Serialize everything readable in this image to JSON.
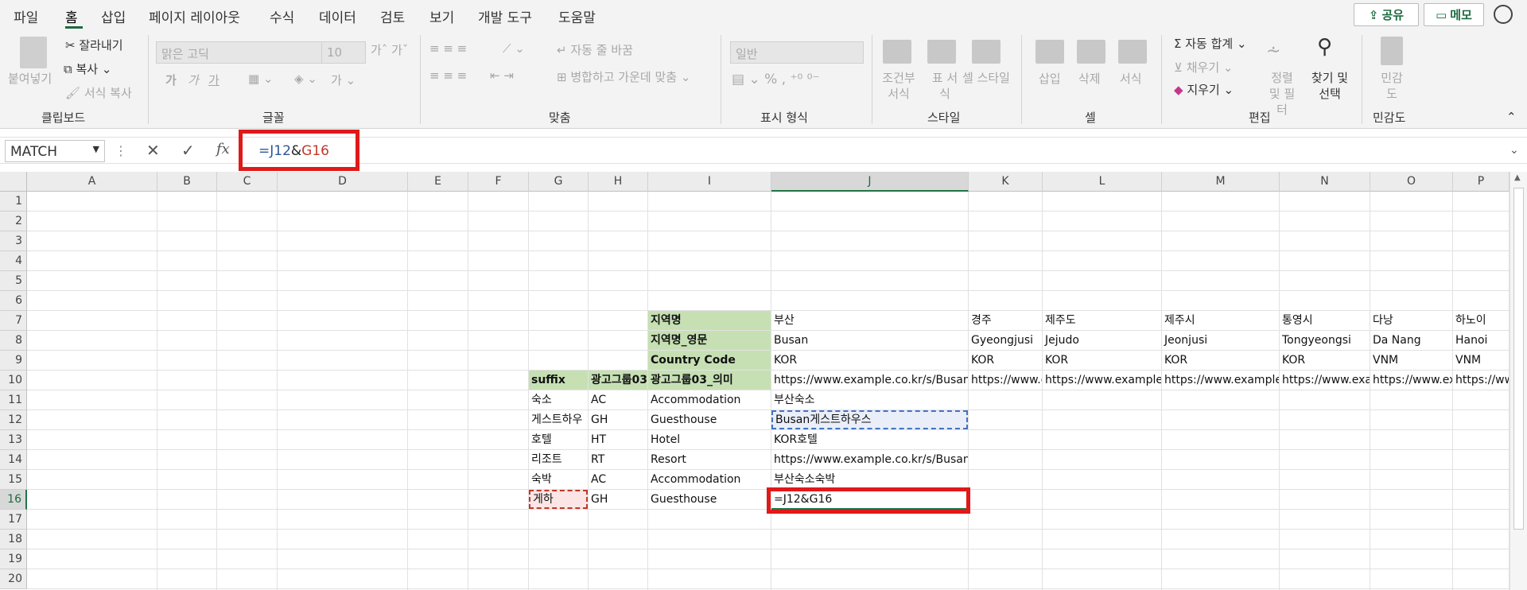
{
  "menu": {
    "items": [
      "파일",
      "홈",
      "삽입",
      "페이지 레이아웃",
      "수식",
      "데이터",
      "검토",
      "보기",
      "개발 도구",
      "도움말"
    ],
    "active_index": 1
  },
  "top_buttons": {
    "share": "공유",
    "comment": "메모"
  },
  "ribbon": {
    "clipboard": {
      "paste": "붙여넣기",
      "cut": "잘라내기",
      "copy": "복사",
      "format_painter": "서식 복사",
      "group": "클립보드"
    },
    "font": {
      "name": "맑은 고딕",
      "size": "10",
      "bold": "가",
      "italic": "가",
      "underline": "가",
      "group": "글꼴"
    },
    "alignment": {
      "wrap": "자동 줄 바꿈",
      "merge": "병합하고 가운데 맞춤",
      "group": "맞춤"
    },
    "number": {
      "format": "일반",
      "group": "표시 형식"
    },
    "styles": {
      "conditional": "조건부 서식",
      "table": "표 서식",
      "cell": "셀 스타일",
      "group": "스타일"
    },
    "cells": {
      "insert": "삽입",
      "delete": "삭제",
      "format": "서식",
      "group": "셀"
    },
    "editing": {
      "autosum": "자동 합계",
      "fill": "채우기",
      "clear": "지우기",
      "sort": "정렬 및 필터",
      "find": "찾기 및 선택",
      "group": "편집"
    },
    "sensitivity": {
      "label": "민감도",
      "group": "민감도"
    }
  },
  "formula_bar": {
    "name_box": "MATCH",
    "formula_ref1": "=J12",
    "formula_amp": "&",
    "formula_ref2": "G16"
  },
  "columns": [
    "A",
    "B",
    "C",
    "D",
    "E",
    "F",
    "G",
    "H",
    "I",
    "J",
    "K",
    "L",
    "M",
    "N",
    "O",
    "P"
  ],
  "rows": [
    "1",
    "2",
    "3",
    "4",
    "5",
    "6",
    "7",
    "8",
    "9",
    "10",
    "11",
    "12",
    "13",
    "14",
    "15",
    "16",
    "17",
    "18",
    "19",
    "20"
  ],
  "cells": {
    "I7": "지역명",
    "J7": "부산",
    "K7": "경주",
    "L7": "제주도",
    "M7": "제주시",
    "N7": "통영시",
    "O7": "다낭",
    "P7": "하노이",
    "I8": "지역명_영문",
    "J8": "Busan",
    "K8": "Gyeongjusi",
    "L8": "Jejudo",
    "M8": "Jeonjusi",
    "N8": "Tongyeongsi",
    "O8": "Da Nang",
    "P8": "Hanoi",
    "I9": "Country Code",
    "J9": "KOR",
    "K9": "KOR",
    "L9": "KOR",
    "M9": "KOR",
    "N9": "KOR",
    "O9": "VNM",
    "P9": "VNM",
    "G10": "suffix",
    "H10": "광고그룹03",
    "I10": "광고그룹03_의미",
    "J10": "https://www.example.co.kr/s/Busan",
    "K10": "https://www.ex",
    "L10": "https://www.example.co",
    "M10": "https://www.example.c",
    "N10": "https://www.exam",
    "O10": "https://www.exa",
    "P10": "https://ww",
    "G11": "숙소",
    "H11": "AC",
    "I11": "Accommodation",
    "J11": "부산숙소",
    "G12": "게스트하우",
    "H12": "GH",
    "I12": "Guesthouse",
    "J12": "Busan게스트하우스",
    "G13": "호텔",
    "H13": "HT",
    "I13": "Hotel",
    "J13": "KOR호텔",
    "G14": "리조트",
    "H14": "RT",
    "I14": "Resort",
    "J14": "https://www.example.co.kr/s/Busan리조트",
    "G15": "숙박",
    "H15": "AC",
    "I15": "Accommodation",
    "J15": "부산숙소숙박",
    "G16": "게하",
    "H16": "GH",
    "I16": "Guesthouse",
    "J16": "=J12&G16"
  },
  "colors": {
    "excel_green": "#217346",
    "highlight_red": "#e01919",
    "header_green": "#c6e0b4"
  }
}
